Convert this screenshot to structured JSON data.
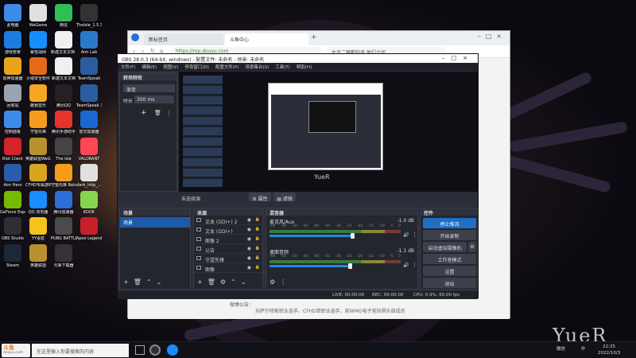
{
  "desktop": {
    "icons": [
      {
        "label": "此电脑",
        "color": "#3d8be6",
        "glyph": "computer-icon"
      },
      {
        "label": "WeGame",
        "color": "#e0e0e0",
        "glyph": "wegame-icon"
      },
      {
        "label": "微信",
        "color": "#2fbf55",
        "glyph": "wechat-icon"
      },
      {
        "label": "TheIsle_1.5.3快捷方式",
        "color": "#333333",
        "glyph": "app-icon"
      },
      {
        "label": "游戏管家",
        "color": "#1f7be0",
        "glyph": "gamepad-icon"
      },
      {
        "label": "暴雪战网",
        "color": "#148eff",
        "glyph": "battlenet-icon"
      },
      {
        "label": "新建文本文档 (2)",
        "color": "#f0f0f0",
        "glyph": "text-file-icon"
      },
      {
        "label": "Aim Lab",
        "color": "#2a78c8",
        "glyph": "aimlab-icon"
      },
      {
        "label": "雷神加速器",
        "color": "#e8a51a",
        "glyph": "speedup-icon"
      },
      {
        "label": "火绒安全软件",
        "color": "#e66a1b",
        "glyph": "shield-icon"
      },
      {
        "label": "新建文本文档",
        "color": "#f0f0f0",
        "glyph": "text-file-icon"
      },
      {
        "label": "TeamSpeak",
        "color": "#2b5c9e",
        "glyph": "teamspeak-icon"
      },
      {
        "label": "回收站",
        "color": "#9aa4b0",
        "glyph": "recycle-bin-icon"
      },
      {
        "label": "酷我音乐",
        "color": "#f5a623",
        "glyph": "music-icon"
      },
      {
        "label": "腾讯QQ",
        "color": "#222222",
        "glyph": "qq-icon"
      },
      {
        "label": "TeamSpeak 3",
        "color": "#2b5c9e",
        "glyph": "teamspeak-icon"
      },
      {
        "label": "控制面板",
        "color": "#3d8be6",
        "glyph": "control-panel-icon"
      },
      {
        "label": "守望先锋",
        "color": "#f49c1b",
        "glyph": "overwatch-icon"
      },
      {
        "label": "腾讯手游助手",
        "color": "#e8322d",
        "glyph": "game-assist-icon"
      },
      {
        "label": "雷光加速器",
        "color": "#1a68d1",
        "glyph": "speedup-icon"
      },
      {
        "label": "Riot Client",
        "color": "#d3232b",
        "glyph": "riot-icon"
      },
      {
        "label": "英雄联盟WeGame版",
        "color": "#b8902f",
        "glyph": "lol-icon"
      },
      {
        "label": "The Isle",
        "color": "#444444",
        "glyph": "app-icon"
      },
      {
        "label": "VALORANT",
        "color": "#ff4655",
        "glyph": "valorant-icon"
      },
      {
        "label": "Aim Hero",
        "color": "#2a5ca8",
        "glyph": "aimhero-icon"
      },
      {
        "label": "CFHD专属游戏大厅",
        "color": "#d8a520",
        "glyph": "cf-icon"
      },
      {
        "label": "守望先锋 Beta",
        "color": "#f49c1b",
        "glyph": "overwatch-icon"
      },
      {
        "label": "dark_http_...",
        "color": "#e0e0e0",
        "glyph": "text-file-icon"
      },
      {
        "label": "GeForce Experience",
        "color": "#76b900",
        "glyph": "nvidia-icon"
      },
      {
        "label": "QQ 浏览器",
        "color": "#1a8cff",
        "glyph": "browser-icon"
      },
      {
        "label": "腾讯加速器",
        "color": "#2d6fd6",
        "glyph": "speedup-icon"
      },
      {
        "label": "KOOK",
        "color": "#87d54c",
        "glyph": "kook-icon"
      },
      {
        "label": "OBS Studio",
        "color": "#302e31",
        "glyph": "obs-icon"
      },
      {
        "label": "YY语音",
        "color": "#f6c21c",
        "glyph": "yy-icon"
      },
      {
        "label": "PUBG BATTLEGR...",
        "color": "#4a4a4a",
        "glyph": "pubg-icon"
      },
      {
        "label": "Apex Legends",
        "color": "#c6202b",
        "glyph": "apex-icon"
      },
      {
        "label": "Steam",
        "color": "#1b2838",
        "glyph": "steam-icon"
      },
      {
        "label": "英雄联盟",
        "color": "#b8902f",
        "glyph": "lol-icon"
      },
      {
        "label": "元争下载器",
        "color": "#333333",
        "glyph": "app-icon"
      }
    ]
  },
  "browser": {
    "tabs": [
      "新标签页",
      "斗鱼中心"
    ],
    "new_tab": "+",
    "address": "https://mp.douyu.com",
    "search_hint": "女子二哪都知道 他们之间",
    "page": {
      "notice_label": "微博公告：",
      "notice_text": "苏萨尔特斯职业选手、CFHD单职业选手、前WMG电子竞技俱乐部成员"
    }
  },
  "obs": {
    "title": "OBS 28.0.3 (64-bit, windows) - 配置文件: 未命名 - 场景: 未命名",
    "menu": [
      "文件(F)",
      "编辑(E)",
      "视图(V)",
      "停靠窗口(D)",
      "配置文件(P)",
      "场景集合(S)",
      "工具(T)",
      "帮助(H)"
    ],
    "transitions": {
      "title": "转场特效",
      "selected": "渐变",
      "duration_label": "时长",
      "duration_value": "300 ms"
    },
    "preview_status": "未选择源",
    "preview_buttons": {
      "properties": "属性",
      "filters": "滤镜"
    },
    "scenes": {
      "title": "场景",
      "items": [
        "场景"
      ]
    },
    "sources": {
      "title": "来源",
      "items": [
        "文本 (GDI+) 2",
        "文本 (GDI+)",
        "图像 2",
        "公告",
        "守望先锋",
        "图像"
      ]
    },
    "mixer": {
      "title": "混音器",
      "channels": [
        {
          "name": "麦克风/Aux",
          "db": "-1.0 dB",
          "level": 0.62
        },
        {
          "name": "桌面音频",
          "db": "-1.1 dB",
          "level": 0.6
        }
      ],
      "scale": [
        "-60",
        "-55",
        "-50",
        "-45",
        "-40",
        "-35",
        "-30",
        "-25",
        "-20",
        "-15",
        "-10",
        "-5",
        "0"
      ]
    },
    "controls": {
      "title": "控件",
      "buttons": [
        "停止推流",
        "开始录制",
        "启动虚拟摄像机",
        "工作室模式",
        "设置",
        "退出"
      ]
    },
    "status": {
      "live": "LIVE: 00:00:00",
      "rec": "REC: 00:00:00",
      "cpu": "CPU: 0.9%, 60.00 fps"
    }
  },
  "taskbar": {
    "logo": "斗鱼",
    "logo_sub": "douyu.com",
    "search_placeholder": "在这里输入你要搜索的内容",
    "time": "22:25",
    "date": "2022/10/3",
    "ime": "中",
    "weather": "微信"
  },
  "watermark": "YueR"
}
